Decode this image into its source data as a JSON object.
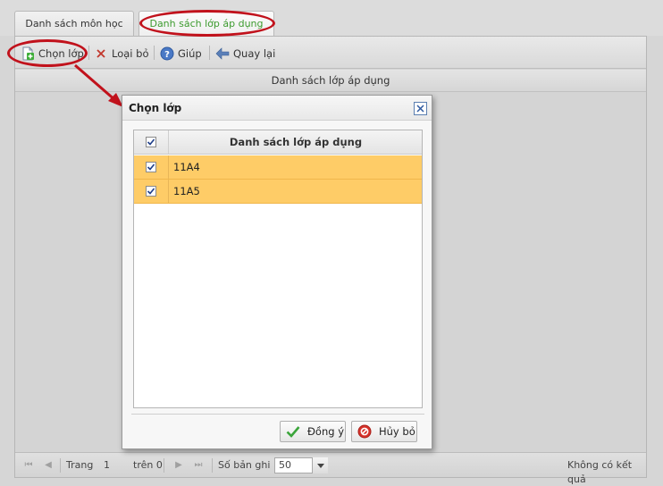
{
  "tabs": [
    {
      "label": "Danh sách môn học"
    },
    {
      "label": "Danh sách lớp áp dụng"
    }
  ],
  "toolbar": {
    "add_label": "Chọn lớp",
    "remove_label": "Loại bỏ",
    "help_label": "Giúp",
    "back_label": "Quay lại"
  },
  "grid": {
    "header": "Danh sách lớp áp dụng"
  },
  "pager": {
    "page_label": "Trang",
    "page_value": "1",
    "of_label": "trên 0",
    "records_label": "Số bản ghi",
    "records_value": "50",
    "status": "Không có kết quả"
  },
  "dialog": {
    "title": "Chọn lớp",
    "column_header": "Danh sách lớp áp dụng",
    "rows": [
      {
        "label": "11A4",
        "checked": true
      },
      {
        "label": "11A5",
        "checked": true
      }
    ],
    "ok_label": "Đồng ý",
    "cancel_label": "Hủy bỏ"
  },
  "colors": {
    "highlight": "#fecc67",
    "annotation": "#c1121c",
    "active_tab": "#3d9b2f"
  }
}
